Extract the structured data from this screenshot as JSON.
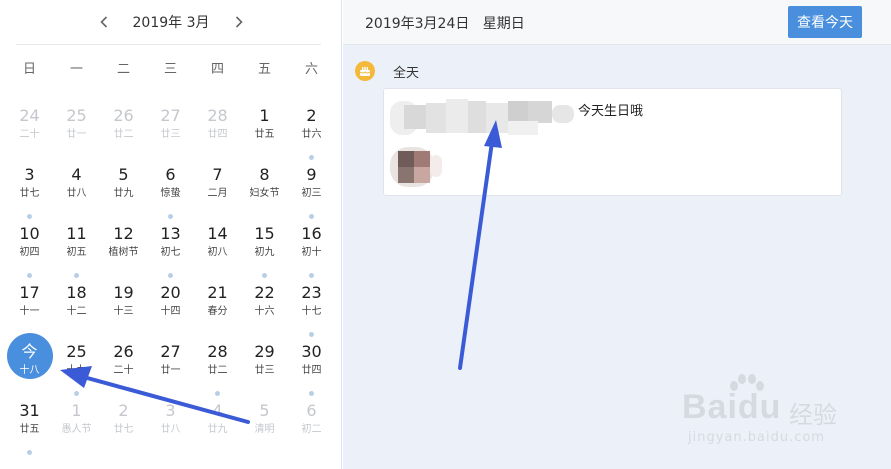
{
  "calendar": {
    "month_label": "2019年 3月",
    "weekdays": [
      "日",
      "一",
      "二",
      "三",
      "四",
      "五",
      "六"
    ],
    "days": [
      {
        "num": "24",
        "lunar": "二十",
        "dim": true,
        "dot": false
      },
      {
        "num": "25",
        "lunar": "廿一",
        "dim": true,
        "dot": false
      },
      {
        "num": "26",
        "lunar": "廿二",
        "dim": true,
        "dot": false
      },
      {
        "num": "27",
        "lunar": "廿三",
        "dim": true,
        "dot": false
      },
      {
        "num": "28",
        "lunar": "廿四",
        "dim": true,
        "dot": false
      },
      {
        "num": "1",
        "lunar": "廿五",
        "dim": false,
        "dot": false
      },
      {
        "num": "2",
        "lunar": "廿六",
        "dim": false,
        "dot": true
      },
      {
        "num": "3",
        "lunar": "廿七",
        "dim": false,
        "dot": true
      },
      {
        "num": "4",
        "lunar": "廿八",
        "dim": false,
        "dot": false
      },
      {
        "num": "5",
        "lunar": "廿九",
        "dim": false,
        "dot": false
      },
      {
        "num": "6",
        "lunar": "惊蛰",
        "dim": false,
        "dot": true
      },
      {
        "num": "7",
        "lunar": "二月",
        "dim": false,
        "dot": false
      },
      {
        "num": "8",
        "lunar": "妇女节",
        "dim": false,
        "dot": false
      },
      {
        "num": "9",
        "lunar": "初三",
        "dim": false,
        "dot": true
      },
      {
        "num": "10",
        "lunar": "初四",
        "dim": false,
        "dot": true
      },
      {
        "num": "11",
        "lunar": "初五",
        "dim": false,
        "dot": true
      },
      {
        "num": "12",
        "lunar": "植树节",
        "dim": false,
        "dot": false
      },
      {
        "num": "13",
        "lunar": "初七",
        "dim": false,
        "dot": true
      },
      {
        "num": "14",
        "lunar": "初八",
        "dim": false,
        "dot": false
      },
      {
        "num": "15",
        "lunar": "初九",
        "dim": false,
        "dot": true
      },
      {
        "num": "16",
        "lunar": "初十",
        "dim": false,
        "dot": true
      },
      {
        "num": "17",
        "lunar": "十一",
        "dim": false,
        "dot": false
      },
      {
        "num": "18",
        "lunar": "十二",
        "dim": false,
        "dot": false
      },
      {
        "num": "19",
        "lunar": "十三",
        "dim": false,
        "dot": false
      },
      {
        "num": "20",
        "lunar": "十四",
        "dim": false,
        "dot": false
      },
      {
        "num": "21",
        "lunar": "春分",
        "dim": false,
        "dot": false
      },
      {
        "num": "22",
        "lunar": "十六",
        "dim": false,
        "dot": false
      },
      {
        "num": "23",
        "lunar": "十七",
        "dim": false,
        "dot": true
      },
      {
        "num": "今",
        "lunar": "十八",
        "dim": false,
        "dot": false,
        "today": true
      },
      {
        "num": "25",
        "lunar": "十九",
        "dim": false,
        "dot": true
      },
      {
        "num": "26",
        "lunar": "二十",
        "dim": false,
        "dot": false
      },
      {
        "num": "27",
        "lunar": "廿一",
        "dim": false,
        "dot": false
      },
      {
        "num": "28",
        "lunar": "廿二",
        "dim": false,
        "dot": true
      },
      {
        "num": "29",
        "lunar": "廿三",
        "dim": false,
        "dot": false
      },
      {
        "num": "30",
        "lunar": "廿四",
        "dim": false,
        "dot": true
      },
      {
        "num": "31",
        "lunar": "廿五",
        "dim": false,
        "dot": true
      },
      {
        "num": "1",
        "lunar": "愚人节",
        "dim": true,
        "dot": false
      },
      {
        "num": "2",
        "lunar": "廿七",
        "dim": true,
        "dot": false
      },
      {
        "num": "3",
        "lunar": "廿八",
        "dim": true,
        "dot": false
      },
      {
        "num": "4",
        "lunar": "廿九",
        "dim": true,
        "dot": false
      },
      {
        "num": "5",
        "lunar": "清明",
        "dim": true,
        "dot": false
      },
      {
        "num": "6",
        "lunar": "初二",
        "dim": true,
        "dot": false
      }
    ]
  },
  "detail": {
    "date_title": "2019年3月24日   星期日",
    "today_button": "查看今天",
    "allday_label": "全天",
    "event_text": "今天生日哦"
  },
  "watermark": {
    "logo": "Baidu",
    "cn": "经验",
    "url": "jingyan.baidu.com"
  },
  "colors": {
    "accent": "#4a8fdd",
    "dot": "#b9cfe8",
    "detail_bg": "#ecf1f9",
    "arrow": "#3b5bd6",
    "birthday_icon": "#f4b93b"
  },
  "icons": {
    "prev": "chevron-left-icon",
    "next": "chevron-right-icon",
    "allday": "birthday-cake-icon"
  }
}
